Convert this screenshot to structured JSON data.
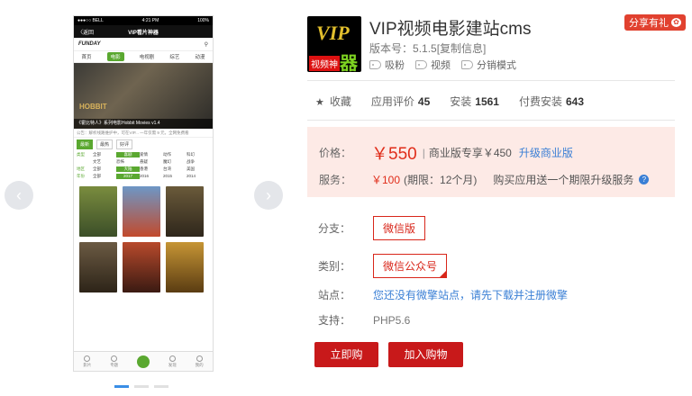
{
  "gallery": {
    "prev": "‹",
    "next": "›",
    "phone": {
      "carrier": "●●●○○ BELL",
      "time": "4:21 PM",
      "battery": "100%",
      "back": "〈返回",
      "title": "VIP看片神器",
      "logo": "FUNDAY",
      "tabs": [
        "首页",
        "电影",
        "电视剧",
        "综艺",
        "动漫"
      ],
      "active_tab": "电影",
      "banner_logo": "HOBBIT",
      "banner_caption": "《霍比特人》系列电影Hobbit Movies v1.4",
      "notice": "公告：解析线路维护中，可在VIP... 一年仅需 9 元，全网免费看",
      "filter_head": [
        "最新",
        "最热",
        "好评"
      ],
      "filter_rows": [
        {
          "label": "类型",
          "items": [
            "全部",
            "喜剧",
            "爱情",
            "动作",
            "科幻"
          ]
        },
        {
          "label": "",
          "items": [
            "文艺",
            "恐怖",
            "悬疑",
            "魔幻",
            "战争"
          ]
        },
        {
          "label": "地区",
          "items": [
            "全部",
            "大陆",
            "香港",
            "台湾",
            "美国"
          ]
        },
        {
          "label": "年份",
          "items": [
            "全部",
            "2017",
            "2016",
            "2015",
            "2014"
          ]
        }
      ],
      "bottom": [
        "影片",
        "专题",
        "",
        "发现",
        "我的"
      ]
    }
  },
  "app": {
    "name": "VIP视频电影建站cms",
    "icon": {
      "vip": "VIP",
      "sub": "视频神",
      "big": "器"
    },
    "version_label": "版本号：",
    "version": "5.1.5",
    "copy_info": "[复制信息]",
    "tags": [
      "吸粉",
      "视频",
      "分销模式"
    ],
    "share": "分享有礼"
  },
  "stats": {
    "favorite": "收藏",
    "rating_label": "应用评价",
    "rating": "45",
    "installs_label": "安装",
    "installs": "1561",
    "paid_label": "付费安装",
    "paid": "643"
  },
  "pricing": {
    "price_label": "价格：",
    "price": "￥550",
    "biz_text": "商业版专享￥450",
    "upgrade": "升级商业版",
    "service_label": "服务：",
    "service_price": "￥100",
    "service_period": "(期限：12个月)",
    "service_tip": "购买应用送一个期限升级服务"
  },
  "options": {
    "branch_label": "分支：",
    "branch_value": "微信版",
    "category_label": "类别：",
    "category_value": "微信公众号",
    "site_label": "站点：",
    "site_text": "您还没有微擎站点，请先下载并注册微擎",
    "support_label": "支持：",
    "support_value": "PHP5.6"
  },
  "actions": {
    "buy": "立即购买",
    "cart": "加入购物车"
  }
}
